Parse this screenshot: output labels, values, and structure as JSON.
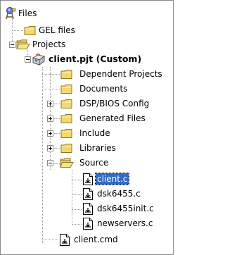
{
  "tree": {
    "root": {
      "label": "Files"
    },
    "gel_files": {
      "label": "GEL files"
    },
    "projects": {
      "label": "Projects"
    },
    "project": {
      "label": "client.pjt (Custom)"
    },
    "dependent_projects": {
      "label": "Dependent Projects"
    },
    "documents": {
      "label": "Documents"
    },
    "dsp_bios_config": {
      "label": "DSP/BIOS Config"
    },
    "generated_files": {
      "label": "Generated Files"
    },
    "include": {
      "label": "Include"
    },
    "libraries": {
      "label": "Libraries"
    },
    "source": {
      "label": "Source",
      "files": [
        {
          "label": "client.c",
          "selected": true
        },
        {
          "label": "dsk6455.c"
        },
        {
          "label": "dsk6455init.c"
        },
        {
          "label": "newservers.c"
        }
      ]
    },
    "client_cmd": {
      "label": "client.cmd"
    }
  },
  "colors": {
    "selection_bg": "#316ac5",
    "folder_fill": "#f5d76e",
    "folder_stroke": "#8a7a2a"
  },
  "icons": {
    "root": "files-icon",
    "folder": "folder-icon",
    "folder_open": "open-folder-icon",
    "project": "project-icon",
    "file": "source-file-icon"
  }
}
